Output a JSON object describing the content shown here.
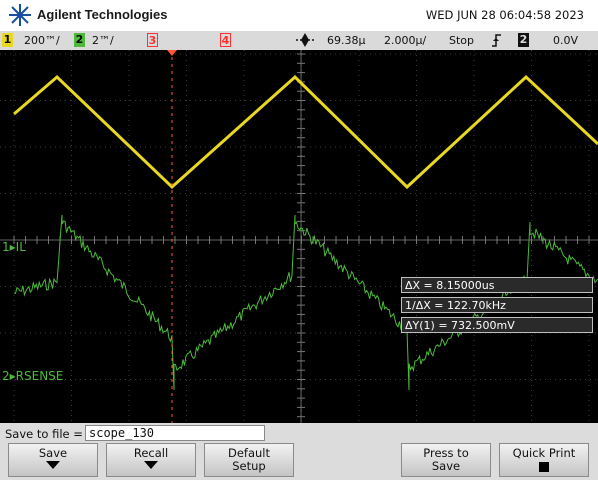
{
  "header": {
    "brand": "Agilent Technologies",
    "datetime": "WED JUN 28 06:04:58 2023"
  },
  "status_bar": {
    "ch1_num": "1",
    "ch1_scale": "200™/",
    "ch2_num": "2",
    "ch2_scale": "2™/",
    "ch3_num": "3",
    "ch4_num": "4",
    "time_offset": "69.38µ",
    "time_scale": "2.000µ/",
    "run_state": "Stop",
    "trigger_icon": "rising-edge-icon",
    "trigger_channel": "2",
    "trigger_level": "0.0V",
    "colors": {
      "ch1": "#e8d820",
      "ch2": "#4cbb3a",
      "ch3": "#ff3030",
      "ch4": "#ff3030"
    }
  },
  "screen": {
    "channel_labels": {
      "ch1": "IL",
      "ch2": "RSENSE",
      "ch1_marker": "1",
      "ch2_marker": "2"
    },
    "measurements": [
      "ΔX = 8.15000us",
      "1/ΔX = 122.70kHz",
      "ΔY(1) = 732.500mV"
    ]
  },
  "save_bar": {
    "label": "Save to file =",
    "filename": "scope_130"
  },
  "softkeys": [
    {
      "line1": "Save",
      "line2": "",
      "icon": "arrow-down-icon"
    },
    {
      "line1": "Recall",
      "line2": "",
      "icon": "arrow-down-icon"
    },
    {
      "line1": "Default",
      "line2": "Setup",
      "icon": ""
    },
    {
      "line1": "Press to",
      "line2": "Save",
      "icon": ""
    },
    {
      "line1": "Quick Print",
      "line2": "",
      "icon": "square-icon"
    }
  ]
}
